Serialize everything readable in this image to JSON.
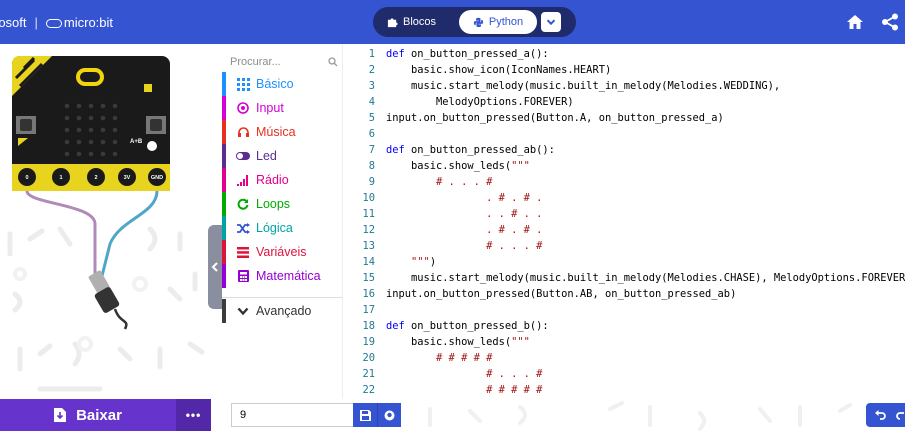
{
  "header": {
    "brand_ms": "rosoft",
    "brand_microbit": "micro:bit",
    "blocks_label": "Blocos",
    "python_label": "Python"
  },
  "toolbox": {
    "search_placeholder": "Procurar...",
    "categories": [
      {
        "label": "Básico",
        "color": "#1e90ff",
        "icon": "grid-icon"
      },
      {
        "label": "Input",
        "color": "#d400d4",
        "icon": "target-icon"
      },
      {
        "label": "Música",
        "color": "#e63022",
        "icon": "headphones-icon"
      },
      {
        "label": "Led",
        "color": "#5c2d91",
        "icon": "toggle-icon"
      },
      {
        "label": "Rádio",
        "color": "#e3008c",
        "icon": "signal-icon"
      },
      {
        "label": "Loops",
        "color": "#00aa00",
        "icon": "refresh-icon"
      },
      {
        "label": "Lógica",
        "color": "#00a4a6",
        "icon": "shuffle-icon"
      },
      {
        "label": "Variáveis",
        "color": "#dc143c",
        "icon": "list-icon"
      },
      {
        "label": "Matemática",
        "color": "#9400d3",
        "icon": "calculator-icon"
      },
      {
        "label": "Avançado",
        "color": "#3c3c3c",
        "icon": "chevron-down-icon"
      }
    ]
  },
  "editor": {
    "line_numbers": [
      "1",
      "2",
      "3",
      "4",
      "5",
      "6",
      "7",
      "8",
      "9",
      "10",
      "11",
      "12",
      "13",
      "14",
      "15",
      "16",
      "17",
      "18",
      "19",
      "20",
      "21",
      "22"
    ],
    "lines": [
      "def on_button_pressed_a():",
      "    basic.show_icon(IconNames.HEART)",
      "    music.start_melody(music.built_in_melody(Melodies.WEDDING),",
      "        MelodyOptions.FOREVER)",
      "input.on_button_pressed(Button.A, on_button_pressed_a)",
      "",
      "def on_button_pressed_ab():",
      "    basic.show_leds(\"\"\"",
      "        # . . . #",
      "                . # . # .",
      "                . . # . .",
      "                . # . # .",
      "                # . . . #",
      "    \"\"\")",
      "    music.start_melody(music.built_in_melody(Melodies.CHASE), MelodyOptions.FOREVER)",
      "input.on_button_pressed(Button.AB, on_button_pressed_ab)",
      "",
      "def on_button_pressed_b():",
      "    basic.show_leds(\"\"\"",
      "        # # # # #",
      "                # . . . #",
      "                # # # # #"
    ]
  },
  "simulator": {
    "pin_labels": [
      "0",
      "1",
      "2",
      "3V",
      "GND"
    ],
    "ab_label": "A+B"
  },
  "footer": {
    "download_label": "Baixar",
    "more_label": "•••",
    "project_name": "9"
  }
}
